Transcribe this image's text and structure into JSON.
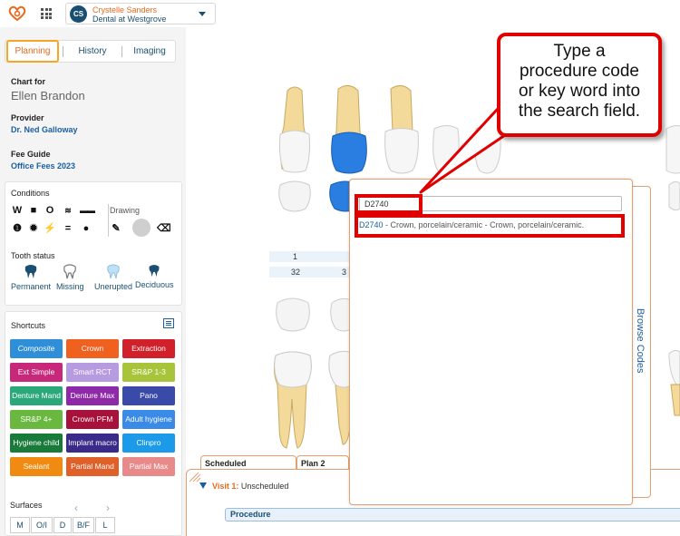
{
  "header": {
    "user_initials": "CS",
    "user_name": "Crystelle Sanders",
    "user_location": "Dental at Westgrove"
  },
  "sidebar": {
    "tabs": [
      "Planning",
      "History",
      "Imaging"
    ],
    "chart_for_label": "Chart for",
    "patient_name": "Ellen Brandon",
    "provider_label": "Provider",
    "provider_name": "Dr. Ned Galloway",
    "fee_guide_label": "Fee Guide",
    "fee_guide_value": "Office Fees 2023",
    "conditions_title": "Conditions",
    "drawing_label": "Drawing",
    "tooth_status_title": "Tooth status",
    "tooth_status_items": [
      "Permanent",
      "Missing",
      "Unerupted",
      "Deciduous"
    ],
    "shortcuts_title": "Shortcuts",
    "shortcuts": [
      {
        "label": "Composite",
        "color": "#2e8fd8"
      },
      {
        "label": "Crown",
        "color": "#f0601e"
      },
      {
        "label": "Extraction",
        "color": "#d2202a"
      },
      {
        "label": "Ext Simple",
        "color": "#c8287a"
      },
      {
        "label": "Smart RCT",
        "color": "#b79be0"
      },
      {
        "label": "SR&P 1-3",
        "color": "#a8c43a"
      },
      {
        "label": "Denture Mand",
        "color": "#2aa87a"
      },
      {
        "label": "Denture Max",
        "color": "#8e2aa8"
      },
      {
        "label": "Pano",
        "color": "#3a4aa8"
      },
      {
        "label": "SR&P 4+",
        "color": "#6ab840"
      },
      {
        "label": "Crown PFM",
        "color": "#a8123a"
      },
      {
        "label": "Adult hygiene",
        "color": "#3a8ae8"
      },
      {
        "label": "Hygiene child",
        "color": "#1a7a3a"
      },
      {
        "label": "Implant macro",
        "color": "#3a2a8a"
      },
      {
        "label": "Clinpro",
        "color": "#1a9ae8"
      },
      {
        "label": "Sealant",
        "color": "#f08a10"
      },
      {
        "label": "Partial Mand",
        "color": "#e0602a"
      },
      {
        "label": "Partial Max",
        "color": "#e88a8a"
      }
    ],
    "surfaces_title": "Surfaces",
    "surfaces": [
      "M",
      "O/I",
      "D",
      "B/F",
      "L"
    ]
  },
  "chart": {
    "upper_number": "1",
    "lower_number": "32",
    "lower_number_partial": "3"
  },
  "bottom": {
    "tabs": [
      "Scheduled",
      "Plan 2"
    ],
    "visit_prefix": "Visit 1:",
    "visit_status": "Unscheduled",
    "procedure_header": "Procedure"
  },
  "search_popup": {
    "search_value": "D2740",
    "result_code": "D2740",
    "result_text": " - Crown, porcelain/ceramic - Crown, porcelain/ceramic.",
    "browse_codes_label": "Browse Codes"
  },
  "callout": {
    "lines": [
      "Type a",
      "procedure code",
      "or key word into",
      "the search field."
    ]
  }
}
